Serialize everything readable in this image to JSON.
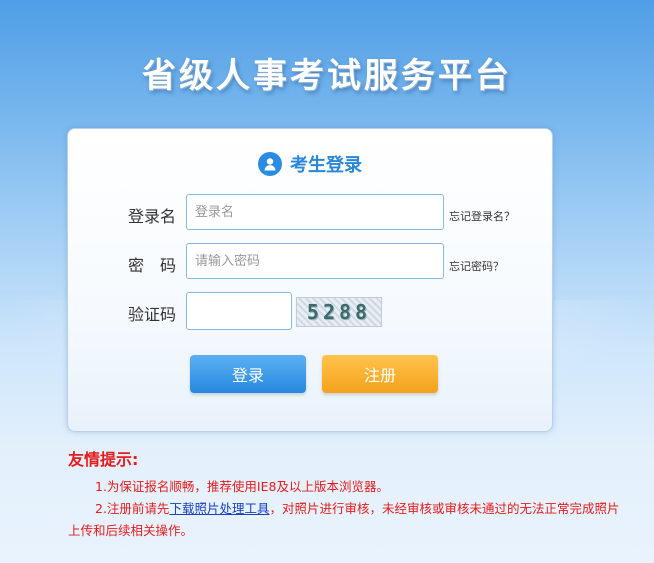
{
  "platform_title": "省级人事考试服务平台",
  "login": {
    "title": "考生登录",
    "username_label": "登录名",
    "username_placeholder": "登录名",
    "forgot_username": "忘记登录名？",
    "password_label": "密　码",
    "password_placeholder": "请输入密码",
    "forgot_password": "忘记密码？",
    "captcha_label": "验证码",
    "captcha_value": "",
    "captcha_image_text": "5288",
    "login_button": "登录",
    "register_button": "注册"
  },
  "notice": {
    "title": "友情提示:",
    "line1": "1.为保证报名顺畅，推荐使用IE8及以上版本浏览器。",
    "line2_prefix": "2.注册前请先",
    "line2_link": "下载照片处理工具",
    "line2_suffix": "，对照片进行审核，未经审核或审核未通过的无法正常完成照片上传和后续相关操作。"
  },
  "colors": {
    "accent_blue": "#2a87d8",
    "register_orange": "#f5a21a",
    "notice_red": "#e51c1c"
  }
}
